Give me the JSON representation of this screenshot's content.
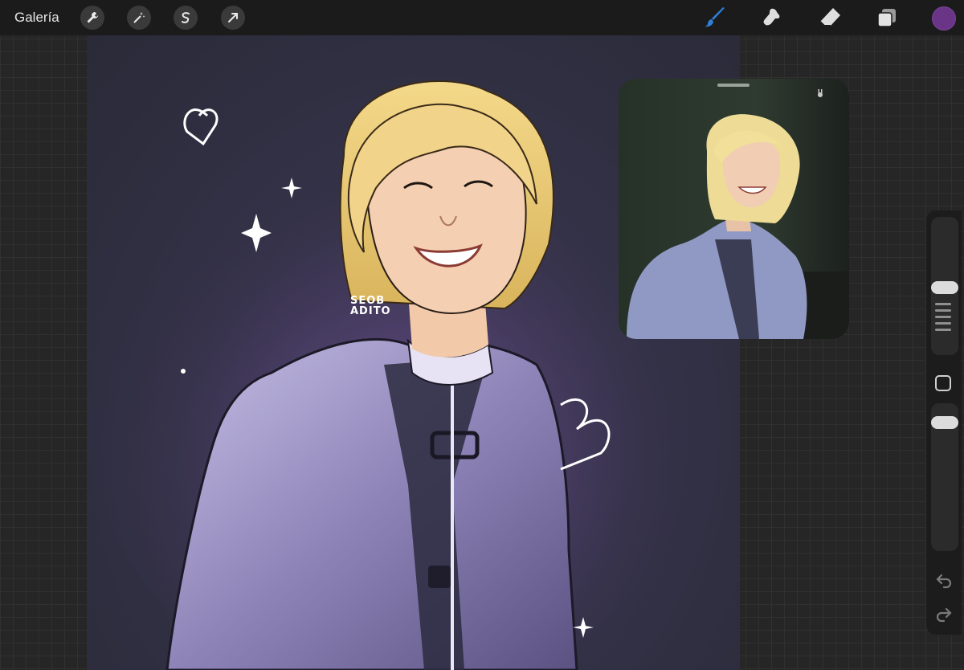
{
  "topbar": {
    "gallery_label": "Galería",
    "left_tools": [
      "wrench-icon",
      "magic-wand-icon",
      "selection-icon",
      "transform-arrow-icon"
    ],
    "right_tools": [
      "brush-icon",
      "smudge-icon",
      "eraser-icon",
      "layers-icon"
    ],
    "current_color": "#6a3586",
    "brush_color": "#2f7fd6"
  },
  "canvas": {
    "watermark_line1": "SEOB",
    "watermark_line2": "ADITO"
  },
  "reference": {
    "label": "reference-photo"
  },
  "sidebar": {
    "tools": [
      "brush-size-slider",
      "modify-button",
      "opacity-slider",
      "undo-icon",
      "redo-icon"
    ]
  }
}
